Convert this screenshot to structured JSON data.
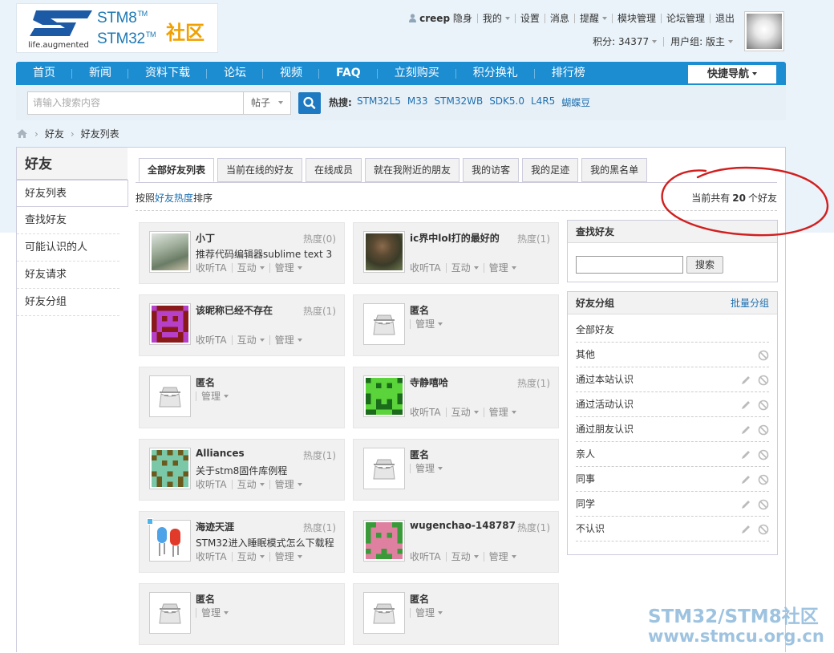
{
  "header": {
    "logo_tagline": "life.augmented",
    "logo_stm8": "STM8",
    "logo_stm32": "STM32",
    "tm": "TM",
    "logo_cn": "社区",
    "username": "creep",
    "user_links": [
      "隐身",
      "我的",
      "设置",
      "消息",
      "提醒",
      "模块管理",
      "论坛管理",
      "退出"
    ],
    "points": "积分: 34377",
    "usergroup": "用户组: 版主"
  },
  "nav": {
    "items": [
      "首页",
      "新闻",
      "资料下载",
      "论坛",
      "视频",
      "FAQ",
      "立刻购买",
      "积分换礼",
      "排行榜"
    ],
    "quick_nav": "快捷导航"
  },
  "search": {
    "placeholder": "请输入搜索内容",
    "scope": "帖子",
    "hot_label": "热搜:",
    "hot_links": [
      "STM32L5",
      "M33",
      "STM32WB",
      "SDK5.0",
      "L4R5",
      "蝴蝶豆"
    ]
  },
  "breadcrumb": [
    "好友",
    "好友列表"
  ],
  "sidebar": {
    "title": "好友",
    "items": [
      "好友列表",
      "查找好友",
      "可能认识的人",
      "好友请求",
      "好友分组"
    ]
  },
  "tabs": [
    "全部好友列表",
    "当前在线的好友",
    "在线成员",
    "就在我附近的朋友",
    "我的访客",
    "我的足迹",
    "我的黑名单"
  ],
  "sort": {
    "prefix": "按照",
    "key": "好友热度",
    "suffix": "排序"
  },
  "total": {
    "prefix": "当前共有",
    "count": "20",
    "suffix": "个好友"
  },
  "actions": {
    "listen": "收听TA",
    "interact": "互动",
    "manage": "管理"
  },
  "friends": [
    {
      "name": "小丁",
      "heat": "热度(0)",
      "sig": "推荐代码编辑器sublime text 3",
      "anon": false,
      "avatar": "photo-person"
    },
    {
      "name": "ic界中lol打的最好的",
      "heat": "热度(1)",
      "sig": "",
      "anon": false,
      "avatar": "photo-soldier"
    },
    {
      "name": "该昵称已经不存在",
      "heat": "热度(1)",
      "sig": "",
      "anon": false,
      "avatar": "pixel-purple"
    },
    {
      "name": "匿名",
      "heat": "",
      "sig": "",
      "anon": true,
      "avatar": "anon"
    },
    {
      "name": "匿名",
      "heat": "",
      "sig": "",
      "anon": true,
      "avatar": "anon"
    },
    {
      "name": "寺静嘻哈",
      "heat": "热度(1)",
      "sig": "",
      "anon": false,
      "avatar": "pixel-green"
    },
    {
      "name": "Alliances",
      "heat": "热度(1)",
      "sig": "关于stm8固件库例程",
      "anon": false,
      "avatar": "pixel-olive"
    },
    {
      "name": "匿名",
      "heat": "",
      "sig": "",
      "anon": true,
      "avatar": "anon"
    },
    {
      "name": "海迹天涯",
      "heat": "热度(1)",
      "sig": "STM32进入睡眠模式怎么下载程",
      "anon": false,
      "avatar": "leds"
    },
    {
      "name": "wugenchao-148787",
      "heat": "热度(1)",
      "sig": "",
      "anon": false,
      "avatar": "pixel-pink"
    },
    {
      "name": "匿名",
      "heat": "",
      "sig": "",
      "anon": true,
      "avatar": "anon"
    },
    {
      "name": "匿名",
      "heat": "",
      "sig": "",
      "anon": true,
      "avatar": "anon"
    }
  ],
  "find_panel": {
    "title": "查找好友",
    "button": "搜索"
  },
  "group_panel": {
    "title": "好友分组",
    "batch": "批量分组",
    "groups": [
      {
        "label": "全部好友",
        "edit": false,
        "del": false
      },
      {
        "label": "其他",
        "edit": false,
        "del": true
      },
      {
        "label": "通过本站认识",
        "edit": true,
        "del": true
      },
      {
        "label": "通过活动认识",
        "edit": true,
        "del": true
      },
      {
        "label": "通过朋友认识",
        "edit": true,
        "del": true
      },
      {
        "label": "亲人",
        "edit": true,
        "del": true
      },
      {
        "label": "同事",
        "edit": true,
        "del": true
      },
      {
        "label": "同学",
        "edit": true,
        "del": true
      },
      {
        "label": "不认识",
        "edit": true,
        "del": true
      }
    ]
  },
  "watermark": {
    "line1": "STM32/STM8社区",
    "line2": "www.stmcu.org.cn"
  },
  "colors": {
    "brand_blue": "#1d8dd2",
    "link": "#1d6fb0",
    "logo_orange": "#f0a000",
    "annotation": "#d11f1f"
  }
}
